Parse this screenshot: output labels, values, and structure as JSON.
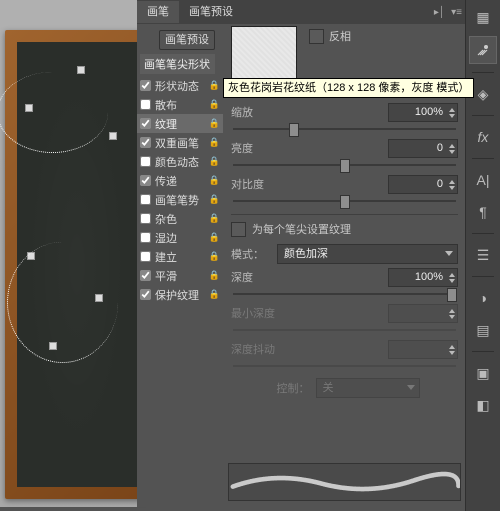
{
  "tabs": [
    "画笔",
    "画笔预设"
  ],
  "preset_button": "画笔预设",
  "option_header": "画笔笔尖形状",
  "options": [
    {
      "label": "形状动态",
      "checked": true,
      "lock": true
    },
    {
      "label": "散布",
      "checked": false,
      "lock": true
    },
    {
      "label": "纹理",
      "checked": true,
      "lock": true,
      "selected": true
    },
    {
      "label": "双重画笔",
      "checked": true,
      "lock": true
    },
    {
      "label": "颜色动态",
      "checked": false,
      "lock": true
    },
    {
      "label": "传递",
      "checked": true,
      "lock": true
    },
    {
      "label": "画笔笔势",
      "checked": false,
      "lock": true
    },
    {
      "label": "杂色",
      "checked": false,
      "lock": true
    },
    {
      "label": "湿边",
      "checked": false,
      "lock": true
    },
    {
      "label": "建立",
      "checked": false,
      "lock": true
    },
    {
      "label": "平滑",
      "checked": true,
      "lock": true
    },
    {
      "label": "保护纹理",
      "checked": true,
      "lock": true
    }
  ],
  "invert": {
    "label": "反相"
  },
  "tooltip": "灰色花岗岩花纹纸（128 x 128 像素，灰度 模式）",
  "scale": {
    "label": "缩放",
    "value": "100%"
  },
  "brightness": {
    "label": "亮度",
    "value": "0"
  },
  "contrast": {
    "label": "对比度",
    "value": "0"
  },
  "per_tip": {
    "label": "为每个笔尖设置纹理"
  },
  "mode": {
    "label": "模式：",
    "value": "颜色加深"
  },
  "depth": {
    "label": "深度",
    "value": "100%"
  },
  "min_depth": {
    "label": "最小深度"
  },
  "depth_jitter": {
    "label": "深度抖动"
  },
  "control": {
    "label": "控制：",
    "value": "关"
  }
}
